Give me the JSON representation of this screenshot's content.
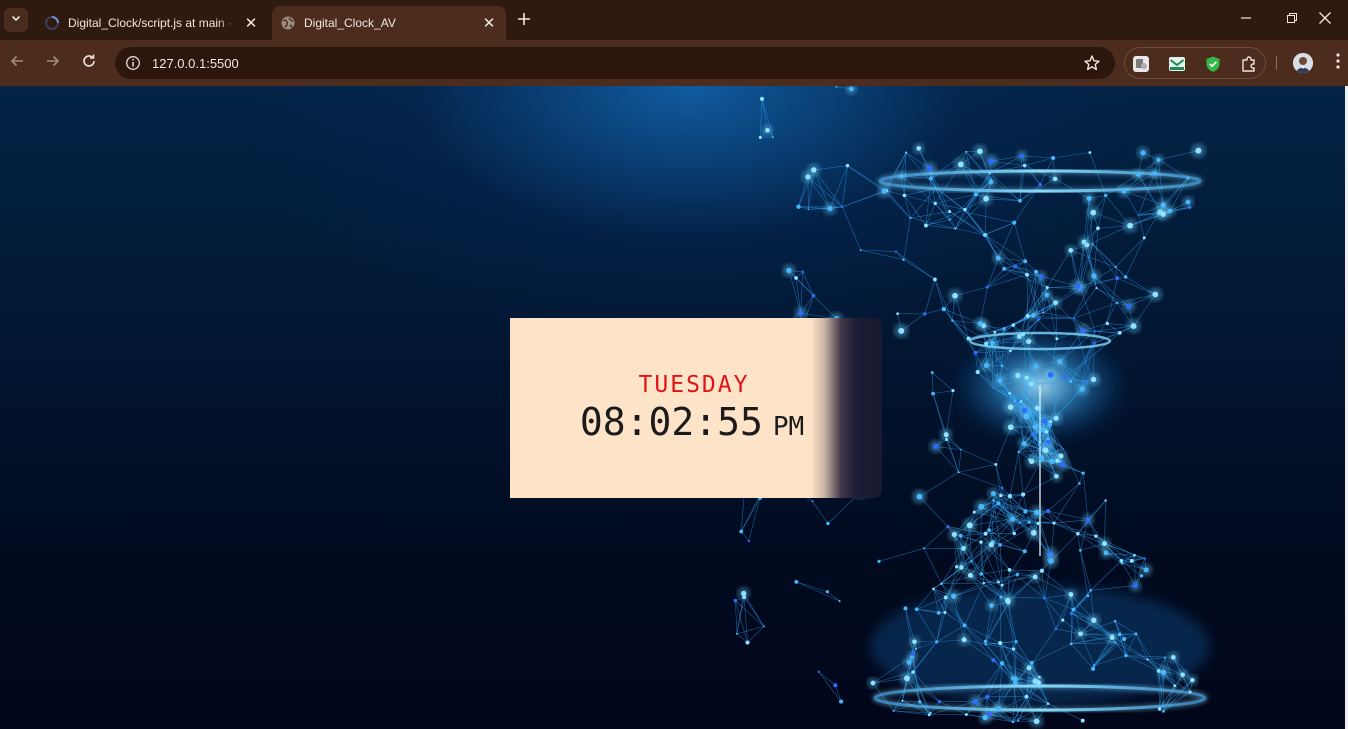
{
  "browser": {
    "tabs": [
      {
        "title": "Digital_Clock/script.js at main · ",
        "active": false,
        "favicon": "github-icon"
      },
      {
        "title": "Digital_Clock_AV",
        "active": true,
        "favicon": "globe-icon"
      }
    ],
    "address_bar": {
      "url": "127.0.0.1:5500"
    },
    "colors": {
      "frame": "#2f1a10",
      "toolbar": "#4b2c1d",
      "omnibox": "#2b170e"
    }
  },
  "page": {
    "clock": {
      "day": "TUESDAY",
      "time": "08:02:55",
      "period": "PM"
    },
    "colors": {
      "day_text": "#e01414",
      "card_bg": "#fde3c7",
      "page_bg": "#021632",
      "accent_glow": "#35b8ff"
    }
  }
}
